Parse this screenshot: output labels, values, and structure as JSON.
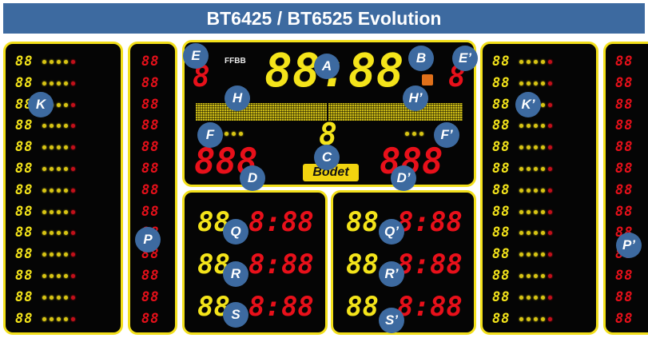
{
  "title": "BT6425 / BT6525 Evolution",
  "colors": {
    "frame": "#f2df1a",
    "board": "#050505",
    "yellow_led": "#f4e41a",
    "red_led": "#e8101a",
    "marker": "#3d6aa0"
  },
  "center": {
    "logo_text": "FFBB",
    "clock": "88:88",
    "period_digit": "8",
    "home_side_digit": "8",
    "guest_side_digit": "8",
    "home_score": "888",
    "guest_score": "888",
    "brand": "Bodet"
  },
  "markers": {
    "A": "A",
    "B": "B",
    "C": "C",
    "D": "D",
    "D2": "D’",
    "E": "E",
    "E2": "E’",
    "F": "F",
    "F2": "F’",
    "H": "H",
    "H2": "H’",
    "K": "K",
    "K2": "K’",
    "P": "P",
    "P2": "P’",
    "Q": "Q",
    "Q2": "Q’",
    "R": "R",
    "R2": "R’",
    "S": "S",
    "S2": "S’"
  },
  "player_digits": "88",
  "penalty_digits": "88",
  "penalty_rows": [
    {
      "number": "88",
      "time": "8:88"
    },
    {
      "number": "88",
      "time": "8:88"
    },
    {
      "number": "88",
      "time": "8:88"
    }
  ]
}
